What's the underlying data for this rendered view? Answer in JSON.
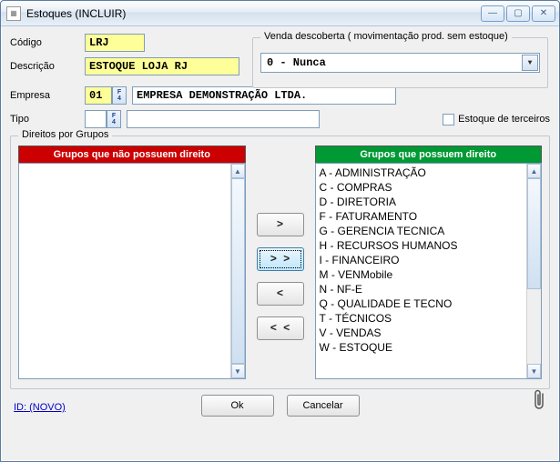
{
  "window": {
    "title": "Estoques (INCLUIR)"
  },
  "labels": {
    "codigo": "Código",
    "descricao": "Descrição",
    "empresa": "Empresa",
    "tipo": "Tipo",
    "estoque_terceiros": "Estoque de terceiros",
    "direitos": "Direitos por Grupos"
  },
  "fields": {
    "codigo": "LRJ",
    "descricao": "ESTOQUE LOJA RJ",
    "empresa_code": "01",
    "empresa_name": "EMPRESA DEMONSTRAÇÃO LTDA.",
    "tipo_code": "",
    "tipo_desc": ""
  },
  "venda": {
    "legend": "Venda descoberta ( movimentação prod. sem estoque)",
    "selected": "0 - Nunca"
  },
  "groups": {
    "left_header": "Grupos que não possuem direito",
    "right_header": "Grupos que possuem direito",
    "left_items": [],
    "right_items": [
      "A - ADMINISTRAÇÃO",
      "C - COMPRAS",
      "D - DIRETORIA",
      "F - FATURAMENTO",
      "G - GERENCIA TECNICA",
      "H - RECURSOS HUMANOS",
      "I - FINANCEIRO",
      "M - VENMobile",
      "N - NF-E",
      "Q - QUALIDADE E TECNO",
      "T - TÉCNICOS",
      "V - VENDAS",
      "W - ESTOQUE"
    ]
  },
  "movebtns": {
    "add_one": ">",
    "add_all": "> >",
    "remove_one": "<",
    "remove_all": "< <"
  },
  "buttons": {
    "ok": "Ok",
    "cancel": "Cancelar",
    "id": "ID: (NOVO)"
  }
}
